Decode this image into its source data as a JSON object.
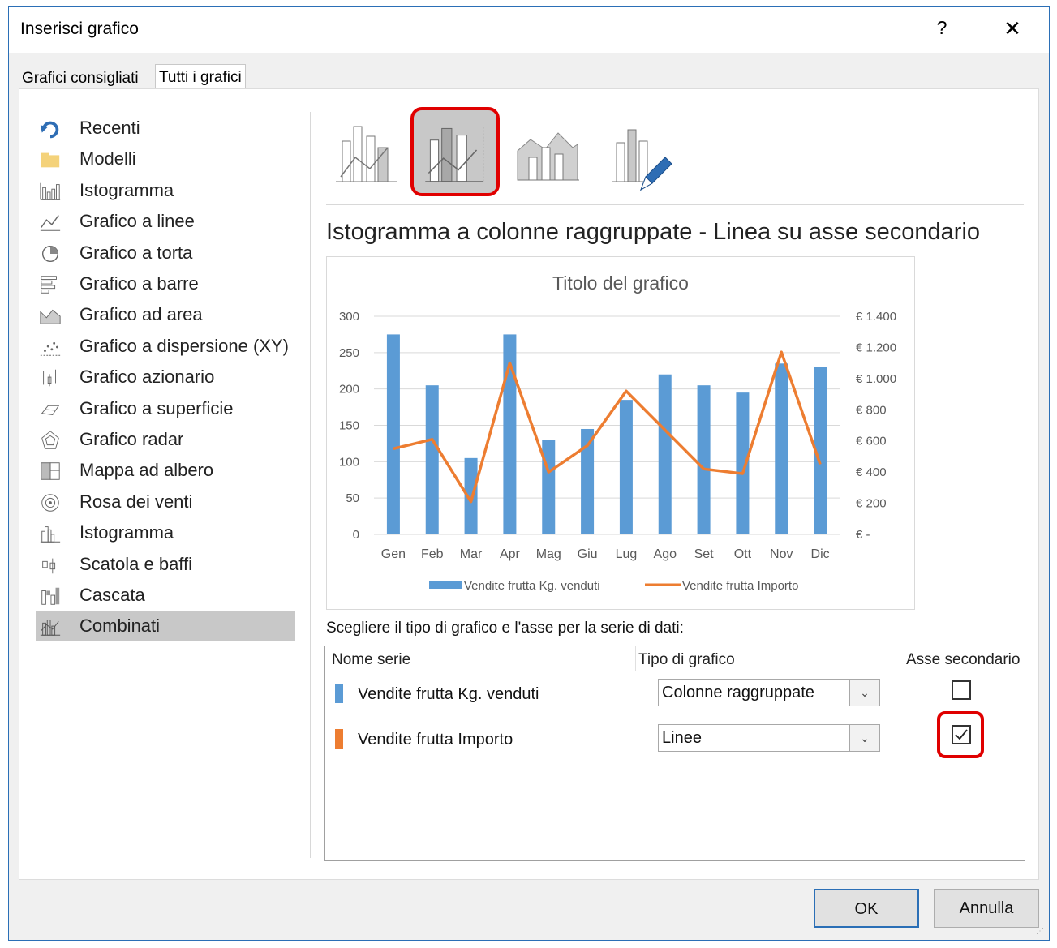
{
  "window": {
    "title": "Inserisci grafico",
    "help_label": "?",
    "close_label": "✕"
  },
  "tabs": [
    {
      "label": "Grafici consigliati"
    },
    {
      "label": "Tutti i grafici"
    }
  ],
  "sidebar": {
    "items": [
      {
        "label": "Recenti",
        "icon": "recent-icon"
      },
      {
        "label": "Modelli",
        "icon": "folder-icon"
      },
      {
        "label": "Istogramma",
        "icon": "column-chart-icon"
      },
      {
        "label": "Grafico a linee",
        "icon": "line-chart-icon"
      },
      {
        "label": "Grafico a torta",
        "icon": "pie-chart-icon"
      },
      {
        "label": "Grafico a barre",
        "icon": "bar-chart-icon"
      },
      {
        "label": "Grafico ad area",
        "icon": "area-chart-icon"
      },
      {
        "label": "Grafico a dispersione (XY)",
        "icon": "scatter-chart-icon"
      },
      {
        "label": "Grafico azionario",
        "icon": "stock-chart-icon"
      },
      {
        "label": "Grafico a superficie",
        "icon": "surface-chart-icon"
      },
      {
        "label": "Grafico radar",
        "icon": "radar-chart-icon"
      },
      {
        "label": "Mappa ad albero",
        "icon": "treemap-icon"
      },
      {
        "label": "Rosa dei venti",
        "icon": "sunburst-icon"
      },
      {
        "label": "Istogramma",
        "icon": "histogram-icon"
      },
      {
        "label": "Scatola e baffi",
        "icon": "box-whisker-icon"
      },
      {
        "label": "Cascata",
        "icon": "waterfall-icon"
      },
      {
        "label": "Combinati",
        "icon": "combo-chart-icon",
        "selected": true
      }
    ]
  },
  "subtypes": [
    {
      "icon": "clustered-column-line-icon"
    },
    {
      "icon": "clustered-column-line-secondary-axis-icon",
      "selected": true
    },
    {
      "icon": "stacked-area-clustered-column-icon"
    },
    {
      "icon": "custom-combination-icon"
    }
  ],
  "subtitle": "Istogramma a colonne raggruppate - Linea su asse secondario",
  "chart_data": {
    "type": "bar",
    "title": "Titolo del grafico",
    "categories": [
      "Gen",
      "Feb",
      "Mar",
      "Apr",
      "Mag",
      "Giu",
      "Lug",
      "Ago",
      "Set",
      "Ott",
      "Nov",
      "Dic"
    ],
    "ylim": [
      0,
      300
    ],
    "yticks": [
      "0",
      "50",
      "100",
      "150",
      "200",
      "250",
      "300"
    ],
    "y2lim": [
      0,
      1400
    ],
    "y2ticks": [
      "€ -",
      "€ 200",
      "€ 400",
      "€ 600",
      "€ 800",
      "€ 1.000",
      "€ 1.200",
      "€ 1.400"
    ],
    "series": [
      {
        "name": "Vendite frutta Kg. venduti",
        "type": "bar",
        "axis": "primary",
        "color": "#5b9bd5",
        "values": [
          275,
          205,
          105,
          275,
          130,
          145,
          185,
          220,
          205,
          195,
          235,
          230
        ]
      },
      {
        "name": "Vendite frutta Importo",
        "type": "line",
        "axis": "secondary",
        "color": "#ed7d31",
        "values": [
          550,
          610,
          210,
          1100,
          400,
          570,
          920,
          670,
          420,
          390,
          1170,
          450
        ]
      }
    ],
    "grid": true,
    "legend": "bottom"
  },
  "instruction": "Scegliere il tipo di grafico e l'asse per la serie di dati:",
  "series_table": {
    "headers": {
      "name": "Nome serie",
      "type": "Tipo di grafico",
      "axis": "Asse secondario"
    },
    "rows": [
      {
        "name": "Vendite frutta Kg. venduti",
        "color": "#5b9bd5",
        "chart_type": "Colonne raggruppate",
        "secondary_axis": false
      },
      {
        "name": "Vendite frutta Importo",
        "color": "#ed7d31",
        "chart_type": "Linee",
        "secondary_axis": true
      }
    ]
  },
  "buttons": {
    "ok": "OK",
    "cancel": "Annulla"
  },
  "colors": {
    "accent": "#2b6fb6",
    "highlight": "#e00000",
    "selected_bg": "#c8c8c8"
  }
}
